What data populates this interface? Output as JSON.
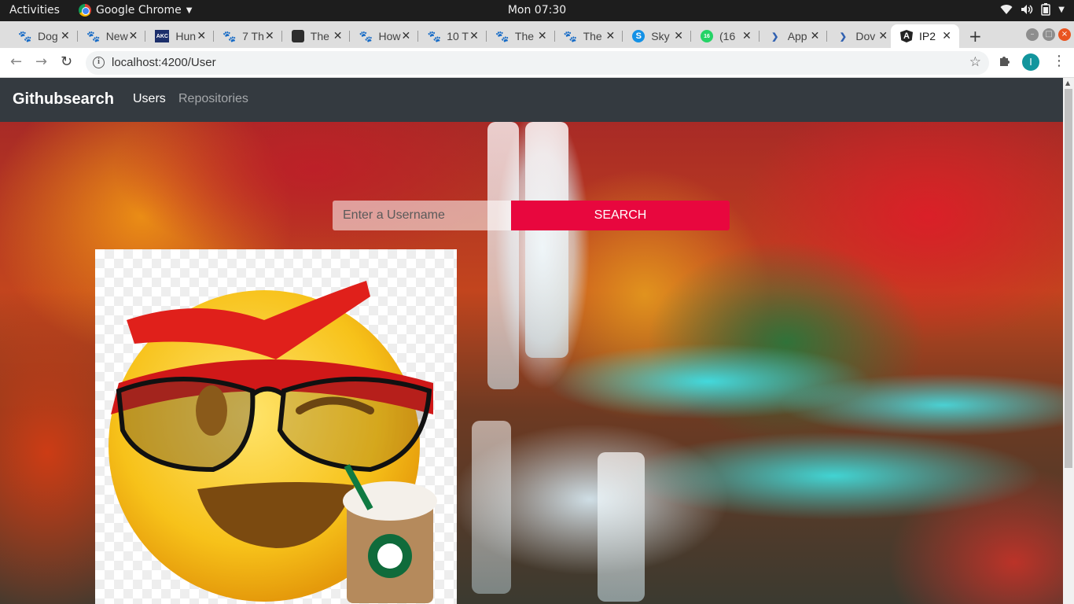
{
  "system_bar": {
    "activities": "Activities",
    "app_name": "Google Chrome",
    "clock": "Mon 07:30",
    "tray_icons": [
      "wifi-icon",
      "volume-icon",
      "battery-icon",
      "chevron-down-icon"
    ]
  },
  "tabs": [
    {
      "label": "Dog",
      "favicon": "paw",
      "active": false
    },
    {
      "label": "New",
      "favicon": "paw",
      "active": false
    },
    {
      "label": "Hun",
      "favicon": "AKC",
      "active": false
    },
    {
      "label": "7 Th",
      "favicon": "paw",
      "active": false
    },
    {
      "label": "The",
      "favicon": "dark",
      "active": false
    },
    {
      "label": "How",
      "favicon": "paw",
      "active": false
    },
    {
      "label": "10 T",
      "favicon": "paw",
      "active": false
    },
    {
      "label": "The",
      "favicon": "paw",
      "active": false
    },
    {
      "label": "The",
      "favicon": "paw",
      "active": false
    },
    {
      "label": "Sky",
      "favicon": "S",
      "active": false
    },
    {
      "label": "(16",
      "favicon": "16",
      "active": false
    },
    {
      "label": "App",
      "favicon": "py",
      "active": false
    },
    {
      "label": "Dov",
      "favicon": "py",
      "active": false
    },
    {
      "label": "IP2",
      "favicon": "A",
      "active": true
    }
  ],
  "browser": {
    "url": "localhost:4200/User",
    "profile_initial": "I"
  },
  "navbar": {
    "brand": "Githubsearch",
    "links": [
      "Users",
      "Repositories"
    ],
    "active_link": "Users"
  },
  "search": {
    "placeholder": "Enter a Username",
    "value": "",
    "button_label": "SEARCH"
  },
  "colors": {
    "navbar_bg": "#343a40",
    "search_button": "#e8073e",
    "active_tab": "#ffffff"
  }
}
